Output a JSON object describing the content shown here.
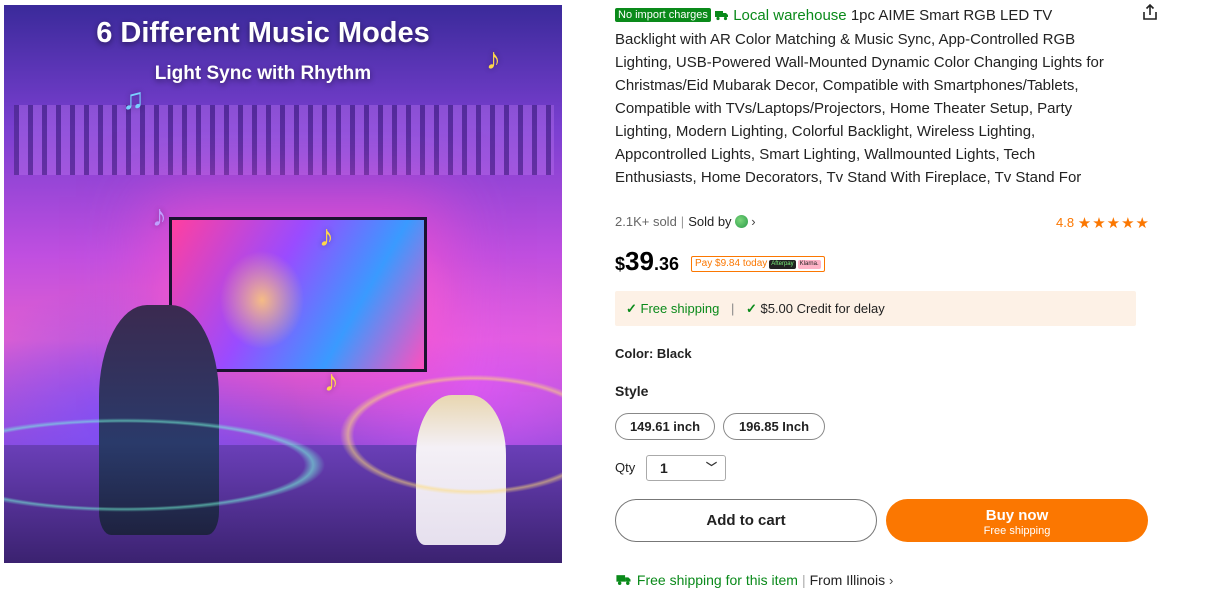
{
  "image": {
    "headline": "6 Different Music Modes",
    "subheadline": "Light Sync with Rhythm"
  },
  "product": {
    "badge_import": "No import charges",
    "local_warehouse": "Local warehouse",
    "title": "1pc AIME Smart RGB LED TV Backlight with AR Color Matching & Music Sync, App-Controlled RGB Lighting, USB-Powered Wall-Mounted Dynamic Color Changing Lights for Christmas/Eid Mubarak Decor, Compatible with Smartphones/Tablets, Compatible with TVs/Laptops/Projectors, Home Theater Setup, Party Lighting, Modern Lighting, Colorful Backlight, Wireless Lighting, Appcontrolled Lights, Smart Lighting, Wallmounted Lights, Tech Enthusiasts, Home Decorators, Tv Stand With Fireplace, Tv Stand For",
    "sold": "2.1K+ sold",
    "sold_by": "Sold by",
    "rating": "4.8",
    "stars": "★★★★★"
  },
  "price": {
    "currency": "$",
    "integer": "39",
    "decimal": ".36",
    "installment": "Pay $9.84 today",
    "installment_provider_1": "Afterpay",
    "installment_provider_2": "Klarna."
  },
  "shipping_bar": {
    "free_shipping": "Free shipping",
    "credit": "$5.00 Credit for delay"
  },
  "options": {
    "color_label": "Color: Black",
    "style_label": "Style",
    "styles": [
      "149.61 inch",
      "196.85 Inch"
    ],
    "qty_label": "Qty",
    "qty_value": "1"
  },
  "actions": {
    "add_to_cart": "Add to cart",
    "buy_now": "Buy now",
    "buy_now_sub": "Free shipping"
  },
  "bottom": {
    "free_shipping_item": "Free shipping for this item",
    "from": "From Illinois"
  },
  "colors": {
    "accent": "#fb7701",
    "green": "#0a8a1a",
    "ship_bar_bg": "#fdf1e6"
  },
  "icons": [
    "truck-icon",
    "share-icon",
    "chevron-right-icon",
    "check-icon",
    "star-icon",
    "chevron-down-icon"
  ]
}
